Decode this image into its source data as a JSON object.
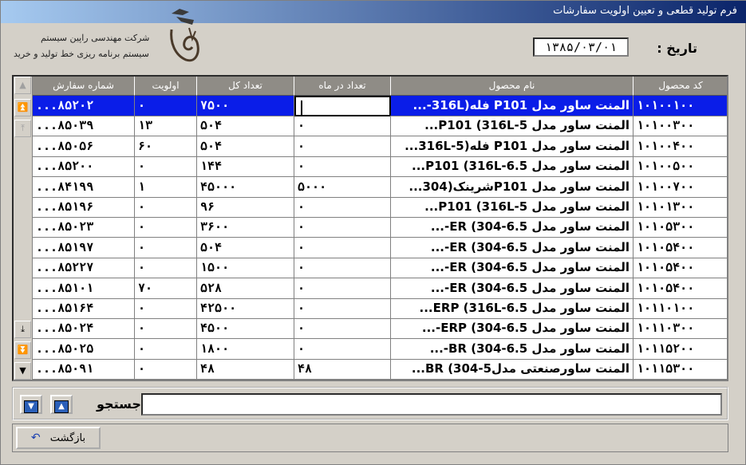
{
  "window": {
    "title": "فرم تولید قطعی و تعیین اولویت سفارشات"
  },
  "logo": {
    "line1": "شرکت مهندسی راپین سیستم",
    "line2": "سیستم برنامه ریزی خط تولید و خرید"
  },
  "date": {
    "label": "تاریخ :",
    "value": "۱۳۸۵/۰۳/۰۱"
  },
  "grid": {
    "headers": {
      "order_no": "شماره سفارش",
      "priority": "اولویت",
      "total_qty": "تعداد کل",
      "monthly_qty": "تعداد در ماه",
      "product_name": "نام محصول",
      "product_code": "کد محصول"
    },
    "rows": [
      {
        "order_no": "...۸۵۲۰۲",
        "priority": "۰",
        "total_qty": "۷۵۰۰",
        "monthly_qty": "",
        "product_name": "المنت ساور مدل P101 فله(316L-...",
        "product_code": "۱۰۱۰۰۱۰۰"
      },
      {
        "order_no": "...۸۵۰۳۹",
        "priority": "۱۳",
        "total_qty": "۵۰۴",
        "monthly_qty": "۰",
        "product_name": "المنت ساور مدل P101  (316L-5...",
        "product_code": "۱۰۱۰۰۳۰۰"
      },
      {
        "order_no": "...۸۵۰۵۶",
        "priority": "۶۰",
        "total_qty": "۵۰۴",
        "monthly_qty": "۰",
        "product_name": "المنت ساور مدل P101 فله(316L-5...",
        "product_code": "۱۰۱۰۰۴۰۰"
      },
      {
        "order_no": "...۸۵۲۰۰",
        "priority": "۰",
        "total_qty": "۱۴۴",
        "monthly_qty": "۰",
        "product_name": "المنت ساور مدل P101 (316L-6.5...",
        "product_code": "۱۰۱۰۰۵۰۰"
      },
      {
        "order_no": "...۸۴۱۹۹",
        "priority": "۱",
        "total_qty": "۴۵۰۰۰",
        "monthly_qty": "۵۰۰۰",
        "product_name": "المنت ساور مدل P101شرینک(304...",
        "product_code": "۱۰۱۰۰۷۰۰"
      },
      {
        "order_no": "...۸۵۱۹۶",
        "priority": "۰",
        "total_qty": "۹۶",
        "monthly_qty": "۰",
        "product_name": "المنت ساور مدل P101  (316L-5...",
        "product_code": "۱۰۱۰۱۳۰۰"
      },
      {
        "order_no": "...۸۵۰۲۳",
        "priority": "۰",
        "total_qty": "۳۶۰۰",
        "monthly_qty": "۰",
        "product_name": "المنت ساور مدل ER  (304-6.5-...",
        "product_code": "۱۰۱۰۵۳۰۰"
      },
      {
        "order_no": "...۸۵۱۹۷",
        "priority": "۰",
        "total_qty": "۵۰۴",
        "monthly_qty": "۰",
        "product_name": "المنت ساور مدل ER  (304-6.5-...",
        "product_code": "۱۰۱۰۵۴۰۰"
      },
      {
        "order_no": "...۸۵۲۲۷",
        "priority": "۰",
        "total_qty": "۱۵۰۰",
        "monthly_qty": "۰",
        "product_name": "المنت ساور مدل ER  (304-6.5-...",
        "product_code": "۱۰۱۰۵۴۰۰"
      },
      {
        "order_no": "...۸۵۱۰۱",
        "priority": "۷۰",
        "total_qty": "۵۲۸",
        "monthly_qty": "۰",
        "product_name": "المنت ساور مدل ER  (304-6.5-...",
        "product_code": "۱۰۱۰۵۴۰۰"
      },
      {
        "order_no": "...۸۵۱۶۴",
        "priority": "۰",
        "total_qty": "۴۲۵۰۰",
        "monthly_qty": "۰",
        "product_name": "المنت ساور مدل ERP (316L-6.5...",
        "product_code": "۱۰۱۱۰۱۰۰"
      },
      {
        "order_no": "...۸۵۰۲۴",
        "priority": "۰",
        "total_qty": "۴۵۰۰",
        "monthly_qty": "۰",
        "product_name": "المنت ساور مدل ERP (304-6.5-...",
        "product_code": "۱۰۱۱۰۳۰۰"
      },
      {
        "order_no": "...۸۵۰۲۵",
        "priority": "۰",
        "total_qty": "۱۸۰۰",
        "monthly_qty": "۰",
        "product_name": "المنت ساور مدل BR  (304-6.5-...",
        "product_code": "۱۰۱۱۵۲۰۰"
      },
      {
        "order_no": "...۸۵۰۹۱",
        "priority": "۰",
        "total_qty": "۴۸",
        "monthly_qty": "۴۸",
        "product_name": "المنت ساورصنعتی مدلBR (304-5...",
        "product_code": "۱۰۱۱۵۳۰۰"
      }
    ]
  },
  "search": {
    "label": "جستجو",
    "value": ""
  },
  "back_button": {
    "label": "بازگشت"
  },
  "colors": {
    "selected_row": "#0a1de8",
    "header_bg": "#8f8c86",
    "titlebar_end": "#0a246a"
  }
}
